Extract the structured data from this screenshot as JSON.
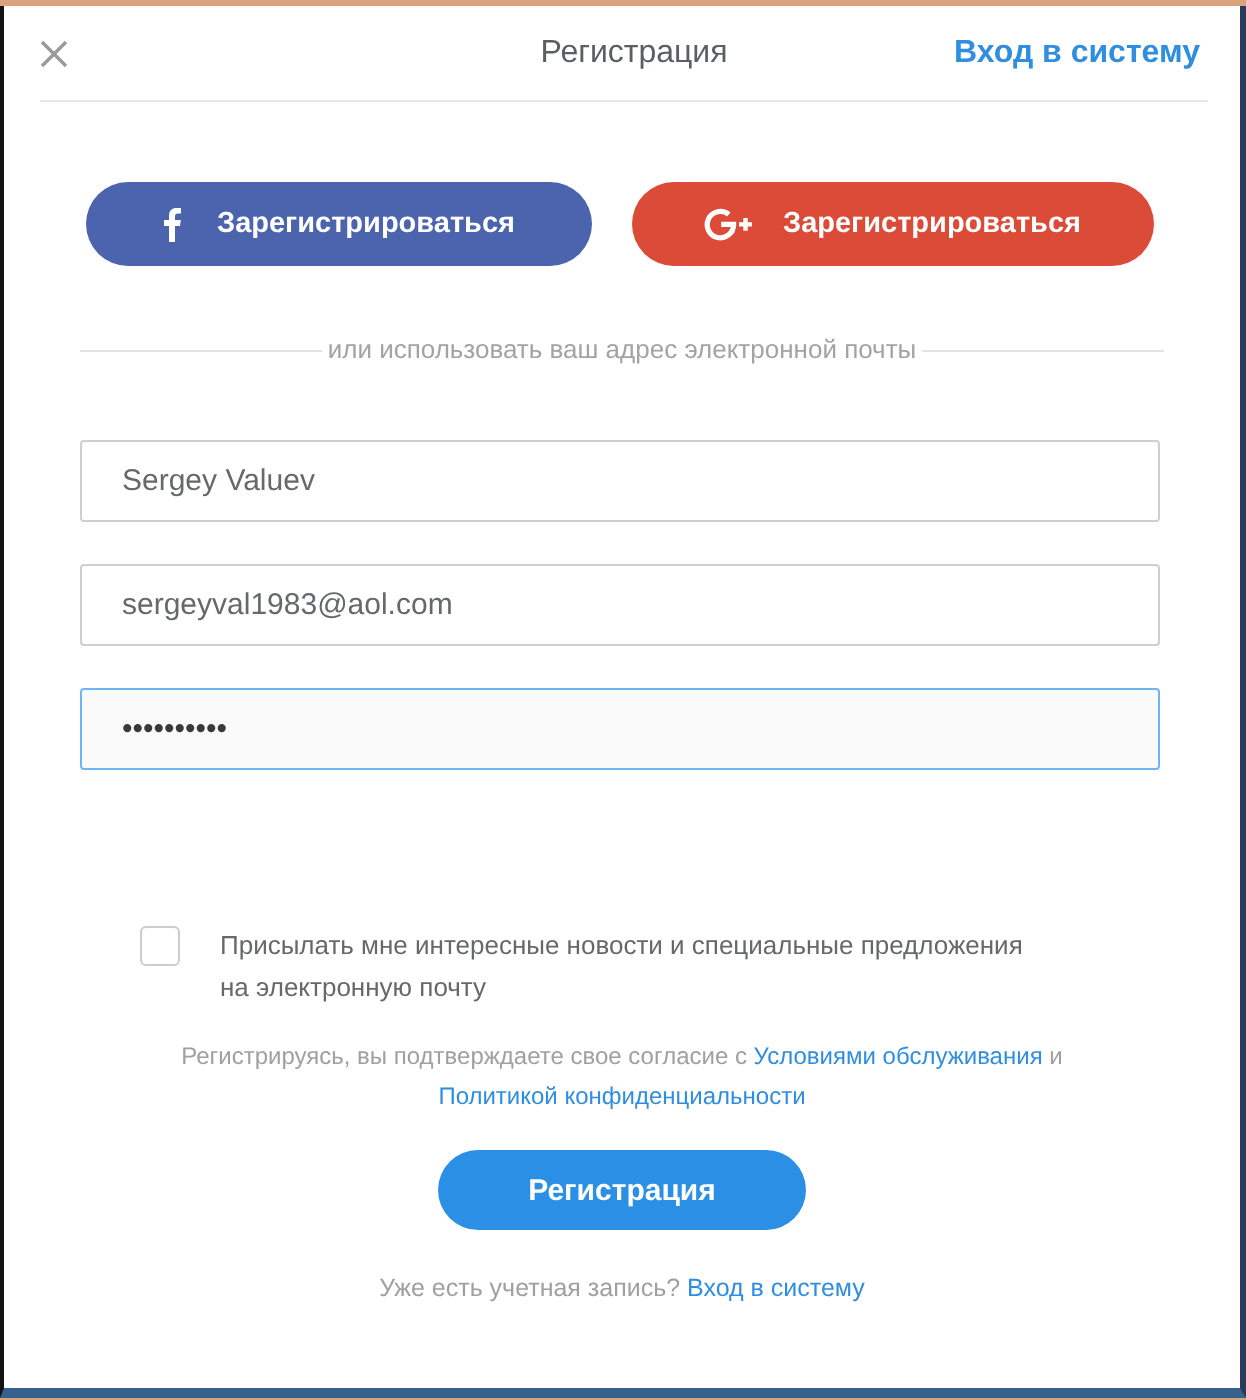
{
  "header": {
    "title": "Регистрация",
    "login_link": "Вход в систему"
  },
  "social_buttons": [
    {
      "kind": "facebook",
      "label": "Зарегистрироваться"
    },
    {
      "kind": "google",
      "label": "Зарегистрироваться"
    }
  ],
  "divider_text": "или использовать ваш адрес электронной почты",
  "fields": [
    {
      "value": "Sergey Valuev",
      "focused": false
    },
    {
      "value": "sergeyval1983@aol.com",
      "focused": false
    },
    {
      "value": "••••••••••",
      "focused": true
    }
  ],
  "newsletter": {
    "checked": false,
    "label": "Присылать мне интересные новости и специальные предложения на электронную почту"
  },
  "terms": {
    "text": "Регистрируясь, вы подтверждаете свое согласие с",
    "terms_link": "Условиями обслуживания",
    "conjunction": "и",
    "privacy_link": "Политикой конфиденциальности"
  },
  "submit_button": "Регистрация",
  "footer": {
    "text": "Уже есть учетная запись?",
    "login_link": "Вход в систему"
  }
}
